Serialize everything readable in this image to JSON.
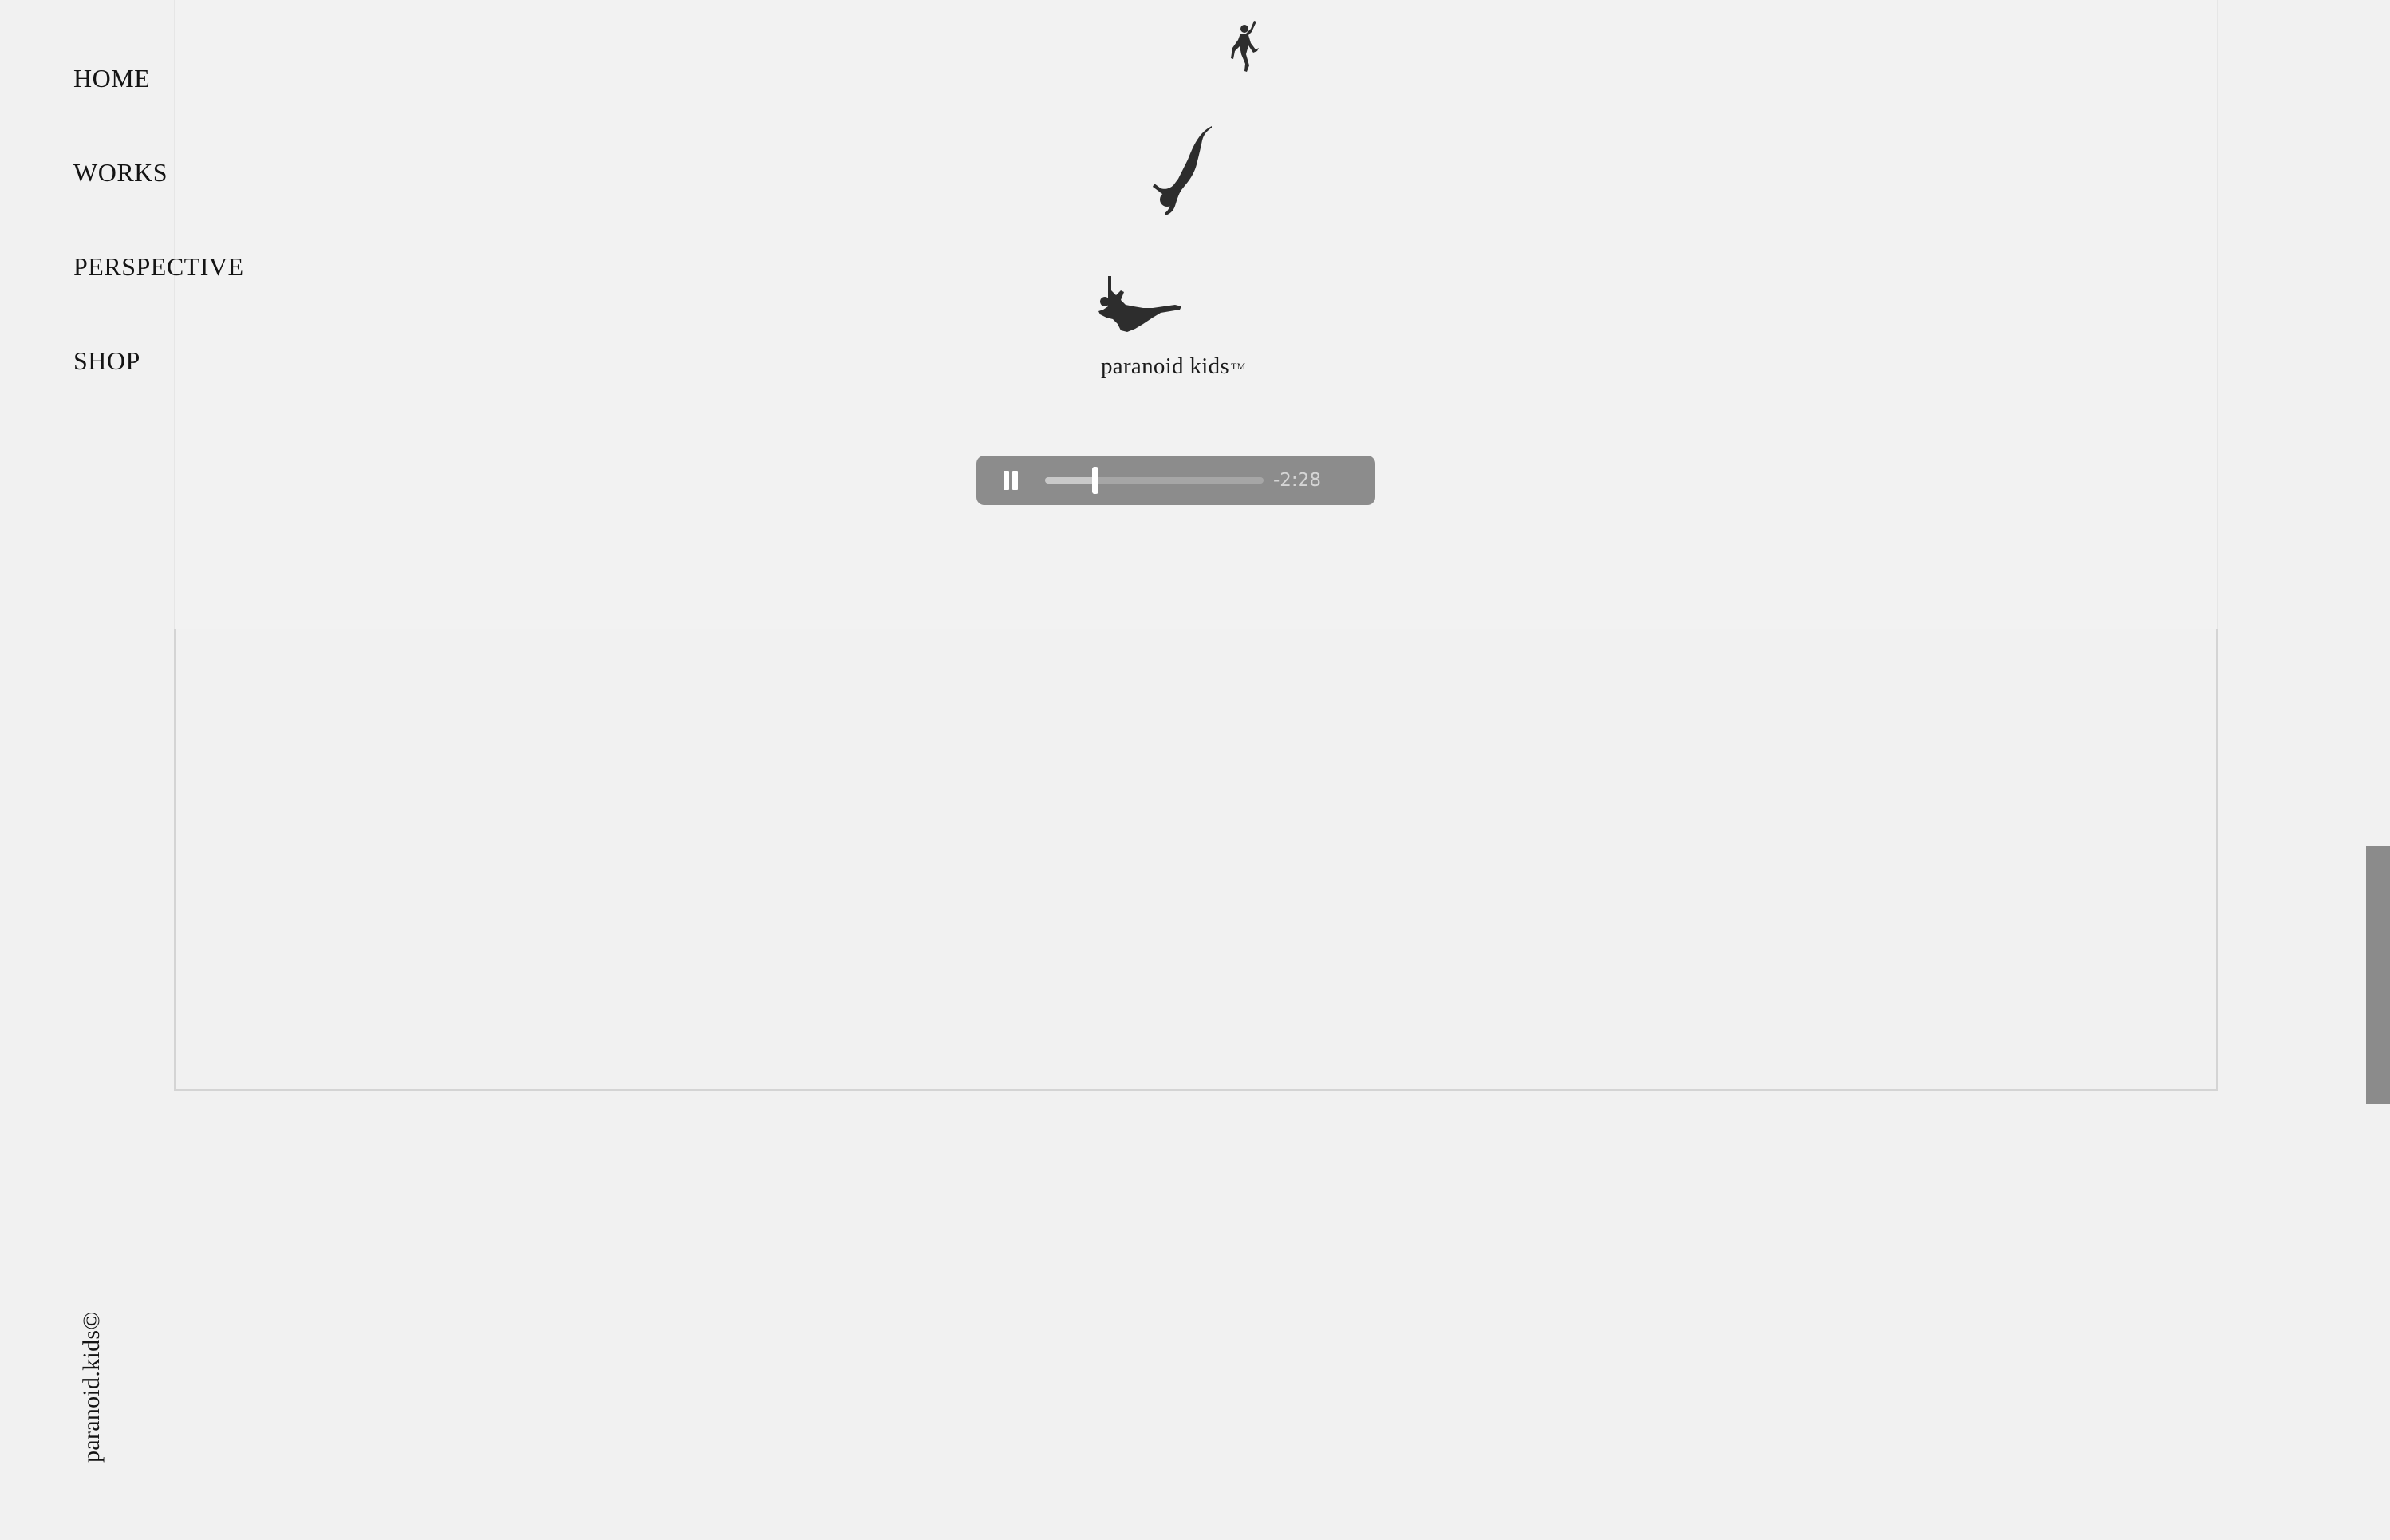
{
  "nav": {
    "items": [
      {
        "label": "HOME"
      },
      {
        "label": "WORKS"
      },
      {
        "label": "PERSPECTIVE"
      },
      {
        "label": "SHOP"
      }
    ]
  },
  "brand": {
    "name": "paranoid kids",
    "trademark": "TM",
    "figures": [
      "falling-figure-icon",
      "diving-figure-icon",
      "reclining-figure-icon"
    ]
  },
  "player": {
    "state": "playing",
    "control_icon": "pause-icon",
    "remaining_time": "-2:28",
    "progress": 0.23
  },
  "footer": {
    "copyright": "paranoid.kids©"
  },
  "colors": {
    "background": "#f1f1f1",
    "player_background": "#8c8c8c",
    "text": "#141414",
    "figure": "#2d2d2d"
  }
}
